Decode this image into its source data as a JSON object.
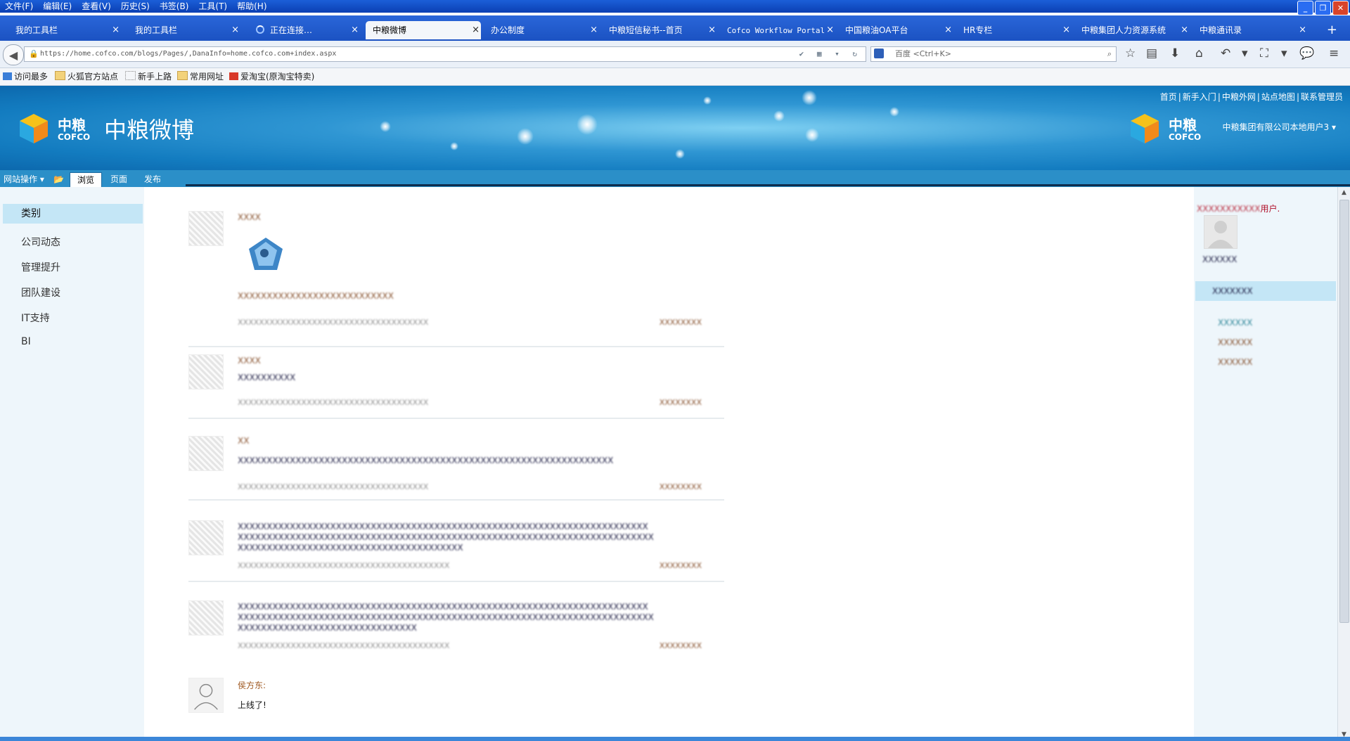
{
  "menubar": {
    "items": [
      "文件(F)",
      "编辑(E)",
      "查看(V)",
      "历史(S)",
      "书签(B)",
      "工具(T)",
      "帮助(H)"
    ]
  },
  "tabs": [
    {
      "label": "我的工具栏"
    },
    {
      "label": "我的工具栏"
    },
    {
      "label": "正在连接…"
    },
    {
      "label": "中粮微博"
    },
    {
      "label": "办公制度"
    },
    {
      "label": "中粮短信秘书--首页"
    },
    {
      "label": "Cofco Workflow Portal"
    },
    {
      "label": "中国粮油OA平台"
    },
    {
      "label": "HR专栏"
    },
    {
      "label": "中粮集团人力资源系统"
    },
    {
      "label": "中粮通讯录"
    }
  ],
  "tab_close_glyph": "×",
  "newtab_glyph": "+",
  "navbar": {
    "url": "https://home.cofco.com/blogs/Pages/,DanaInfo=home.cofco.com+index.aspx",
    "search_placeholder": "百度 <Ctrl+K>"
  },
  "bookmarks": [
    "访问最多",
    "火狐官方站点",
    "新手上路",
    "常用网址",
    "爱淘宝(原淘宝特卖)"
  ],
  "site": {
    "toplinks": [
      "首页",
      "新手入门",
      "中粮外网",
      "站点地图",
      "联系管理员"
    ],
    "logo_cn": "中粮",
    "logo_en": "COFCO",
    "title": "中粮微博",
    "user": "中粮集团有限公司本地用户3"
  },
  "ribbon": {
    "site_actions": "网站操作",
    "tabs": [
      "浏览",
      "页面",
      "发布"
    ]
  },
  "leftnav": {
    "header": "类别",
    "items": [
      "公司动态",
      "管理提升",
      "团队建设",
      "IT支持",
      "BI"
    ]
  },
  "feed": [
    {
      "name": "侯方东",
      "body": "上线了!"
    }
  ],
  "rightpanel": {
    "title_suffix": "用户."
  },
  "colors": {
    "brand_blue": "#137cc0",
    "nav_highlight": "#c4e6f6",
    "name_brown": "#a05a23"
  }
}
